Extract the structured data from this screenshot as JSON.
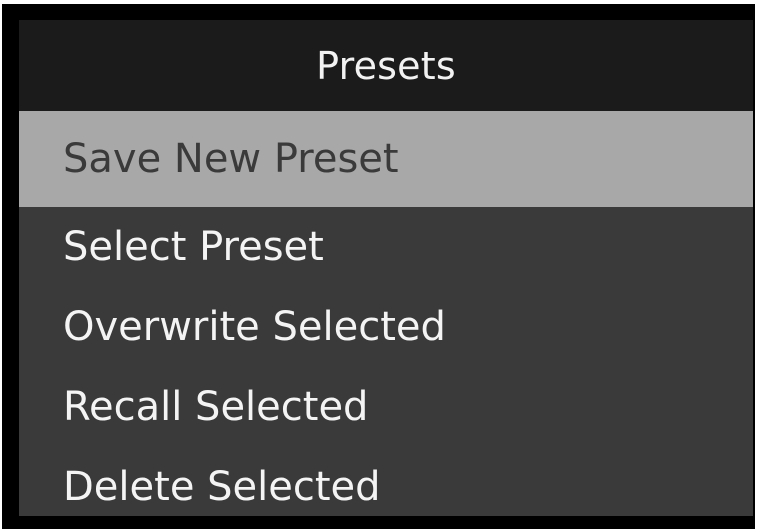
{
  "menu": {
    "title": "Presets",
    "items": [
      {
        "label": "Save New Preset",
        "selected": true
      },
      {
        "label": "Select Preset",
        "selected": false
      },
      {
        "label": "Overwrite Selected",
        "selected": false
      },
      {
        "label": "Recall Selected",
        "selected": false
      },
      {
        "label": "Delete Selected",
        "selected": false
      }
    ]
  },
  "colors": {
    "background": "#3a3a3a",
    "header": "#1b1b1b",
    "highlight": "#a8a8a8",
    "text": "#f4f4f4",
    "highlight_text": "#3a3a3a"
  }
}
